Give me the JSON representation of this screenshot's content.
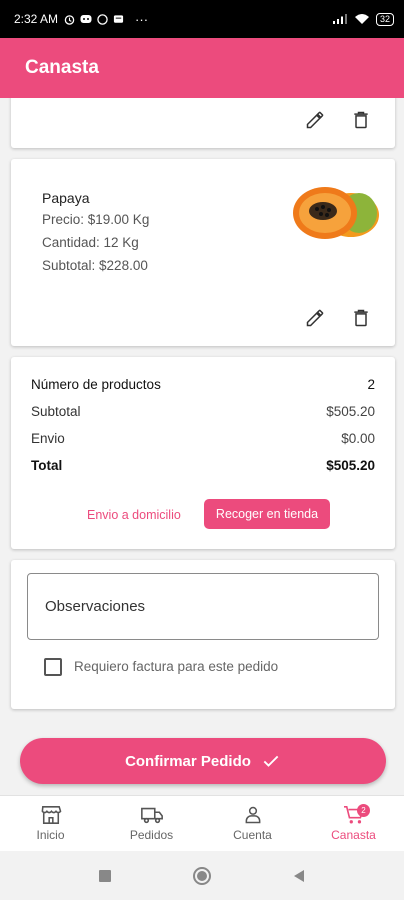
{
  "status": {
    "time": "2:32 AM",
    "battery": "32",
    "more": "···"
  },
  "appbar": {
    "title": "Canasta"
  },
  "product": {
    "name": "Papaya",
    "price": "Precio: $19.00 Kg",
    "quantity": "Cantidad: 12 Kg",
    "subtotal": "Subtotal: $228.00",
    "image_icon": "papaya-image"
  },
  "summary": {
    "num_products_label": "Número de productos",
    "num_products_value": "2",
    "subtotal_label": "Subtotal",
    "subtotal_value": "$505.20",
    "shipping_label": "Envio",
    "shipping_value": "$0.00",
    "total_label": "Total",
    "total_value": "$505.20",
    "delivery_option": "Envio a domicilio",
    "pickup_option": "Recoger en tienda"
  },
  "observations": {
    "placeholder": "Observaciones",
    "invoice_label": "Requiero factura para este pedido"
  },
  "confirm": {
    "label": "Confirmar Pedido"
  },
  "nav": {
    "items": [
      {
        "label": "Inicio",
        "icon": "store-icon"
      },
      {
        "label": "Pedidos",
        "icon": "truck-icon"
      },
      {
        "label": "Cuenta",
        "icon": "person-icon"
      },
      {
        "label": "Canasta",
        "icon": "cart-icon",
        "badge": "2"
      }
    ]
  },
  "colors": {
    "accent": "#ec4b7d",
    "statusbar": "#000000",
    "background": "#f2f2f2"
  }
}
